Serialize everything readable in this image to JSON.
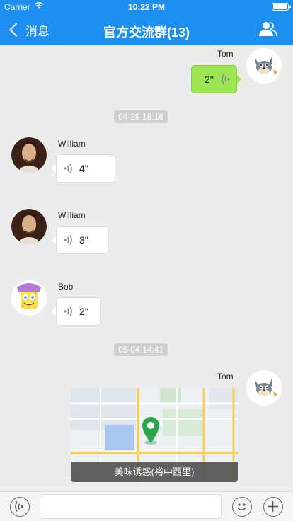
{
  "status_bar": {
    "carrier": "Carrier",
    "time": "10:22 PM"
  },
  "nav": {
    "back_label": "消息",
    "title": "官方交流群(13)"
  },
  "messages": [
    {
      "sender": "Tom",
      "duration": "2''"
    },
    {
      "timestamp": "04-29 18:16"
    },
    {
      "sender": "William",
      "duration": "4''"
    },
    {
      "sender": "William",
      "duration": "3''"
    },
    {
      "sender": "Bob",
      "duration": "2''"
    },
    {
      "timestamp": "05-04 14:41"
    },
    {
      "sender": "Tom",
      "location_label": "美味诱惑(裕中西里)"
    }
  ],
  "input": {
    "placeholder": ""
  },
  "colors": {
    "nav_bg": "#1e8ef1",
    "outgoing_bubble": "#9ee654",
    "chat_bg": "#ececec"
  }
}
